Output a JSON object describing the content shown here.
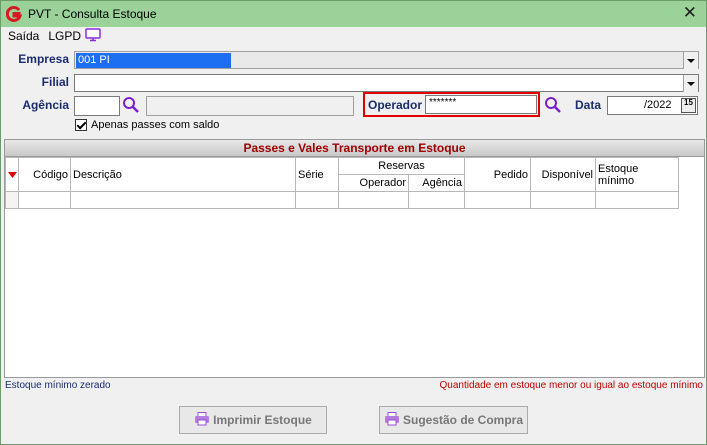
{
  "window": {
    "title": "PVT - Consulta Estoque",
    "close_label": "✕"
  },
  "menu": {
    "items": [
      "Saída",
      "LGPD"
    ],
    "monitor_icon": "monitor-icon"
  },
  "form": {
    "empresa_label": "Empresa",
    "empresa_value": "001 PI",
    "filial_label": "Filial",
    "filial_value": "",
    "agencia_label": "Agência",
    "agencia_code": "",
    "agencia_name": "",
    "operador_label": "Operador",
    "operador_value": "*******",
    "data_label": "Data",
    "data_value": "/2022",
    "date_button": "15",
    "checkbox_label": "Apenas passes com saldo"
  },
  "grid": {
    "caption": "Passes e Vales Transporte em Estoque",
    "columns": [
      "Código",
      "Descrição",
      "Série",
      "Pedido",
      "Disponível",
      "Estoque mínimo"
    ],
    "reservas_label": "Reservas",
    "reservas_sub": [
      "Operador",
      "Agência"
    ]
  },
  "footer": {
    "left": "Estoque mínimo zerado",
    "right": "Quantidade em estoque menor ou igual ao estoque mínimo"
  },
  "buttons": {
    "print_label": "Imprimir Estoque",
    "suggest_label": "Sugestão de Compra"
  },
  "colors": {
    "titlebar": "#9ad29a",
    "accent_red": "#e00000",
    "selection": "#1c6ff0"
  }
}
